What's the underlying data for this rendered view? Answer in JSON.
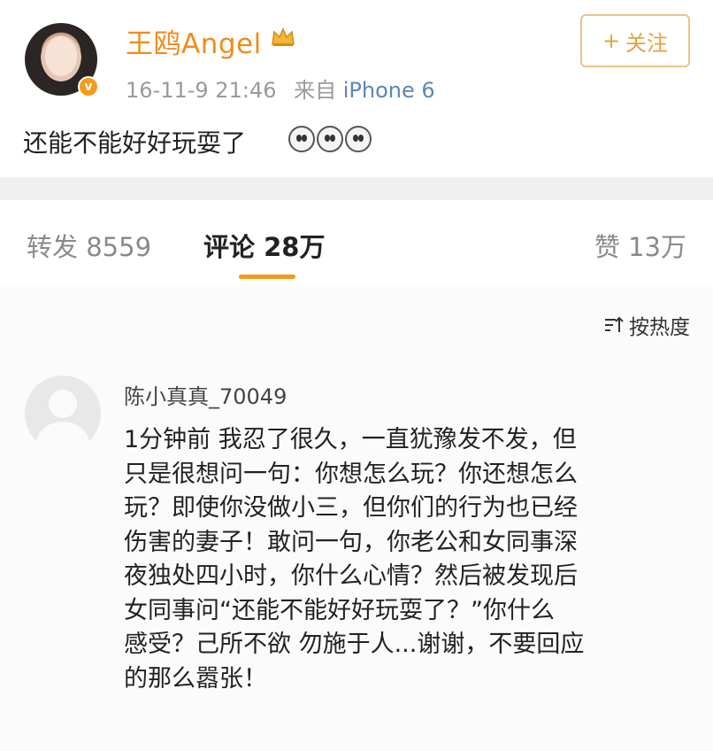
{
  "post": {
    "username": "王鸥Angel",
    "timestamp": "16-11-9 21:46",
    "source_prefix": "来自",
    "device": "iPhone 6",
    "follow_label": "关注",
    "follow_icon": "+",
    "text": "还能不能好好玩耍了",
    "verified_mark": "v",
    "emoji_count": 3
  },
  "tabs": {
    "repost": "转发 8559",
    "comments": "评论 28万",
    "likes": "赞 13万",
    "active": "comments",
    "accent_color": "#f39b1a"
  },
  "comments": {
    "sort_label": "按热度",
    "items": [
      {
        "author": "陈小真真_70049",
        "text": "1分钟前 我忍了很久，一直犹豫发不发，但\n只是很想问一句：你想怎么玩？你还想怎么\n玩？即使你没做小三，但你们的行为也已经\n伤害的妻子！敢问一句，你老公和女同事深\n夜独处四小时，你什么心情？然后被发现后\n女同事问“还能不能好好玩耍了？”你什么\n感受？己所不欲 勿施于人...谢谢，不要回应\n的那么嚣张！"
      }
    ]
  }
}
